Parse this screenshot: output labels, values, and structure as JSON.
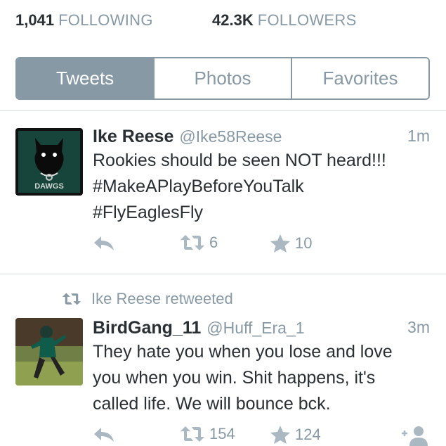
{
  "profile_stats": {
    "following": {
      "count": "1,041",
      "label": "FOLLOWING"
    },
    "followers": {
      "count": "42.3K",
      "label": "FOLLOWERS"
    }
  },
  "tabs": [
    {
      "label": "Tweets",
      "active": true
    },
    {
      "label": "Photos",
      "active": false
    },
    {
      "label": "Favorites",
      "active": false
    }
  ],
  "tweets": [
    {
      "name": "Ike Reese",
      "handle": "@Ike58Reese",
      "time": "1m",
      "text_lines": [
        "Rookies should be seen NOT heard!!!",
        "#MakeAPlayBeforeYouTalk",
        "#FlyEaglesFly"
      ],
      "avatar_text": "DAWGS",
      "retweets": "6",
      "favorites": "10"
    },
    {
      "retweeted_by": "Ike Reese retweeted",
      "name": "BirdGang_11",
      "handle": "@Huff_Era_1",
      "time": "3m",
      "text_lines": [
        "They hate you when you lose and love",
        "you when you win. Shit happens, it's",
        "called life. We will bounce bck."
      ],
      "retweets": "154",
      "favorites": "124"
    }
  ],
  "colors": {
    "accent_gray": "#8899a6",
    "text": "#292f33",
    "icon": "#aab8c2"
  },
  "icons": [
    "reply-icon",
    "retweet-icon",
    "favorite-star-icon",
    "follow-icon"
  ]
}
